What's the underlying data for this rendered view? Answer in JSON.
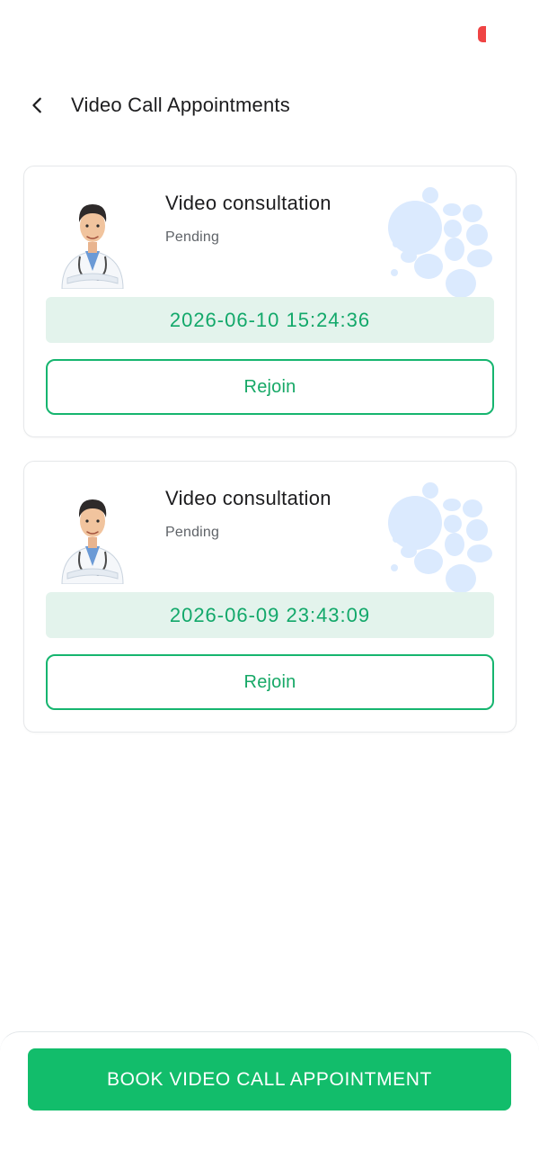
{
  "header": {
    "back_icon": "chevron-left-icon",
    "title": "Video Call Appointments"
  },
  "appointments": [
    {
      "title": "Video consultation",
      "status": "Pending",
      "datetime": "2026-06-10 15:24:36",
      "action_label": "Rejoin",
      "avatar": "doctor-avatar-icon"
    },
    {
      "title": "Video consultation",
      "status": "Pending",
      "datetime": "2026-06-09 23:43:09",
      "action_label": "Rejoin",
      "avatar": "doctor-avatar-icon"
    }
  ],
  "footer": {
    "book_label": "BOOK VIDEO CALL APPOINTMENT"
  },
  "colors": {
    "accent_green": "#12bd6b",
    "date_strip_bg": "#e3f3ec",
    "status_dot": "#ef4444",
    "decor_blob": "#dbeafe"
  }
}
